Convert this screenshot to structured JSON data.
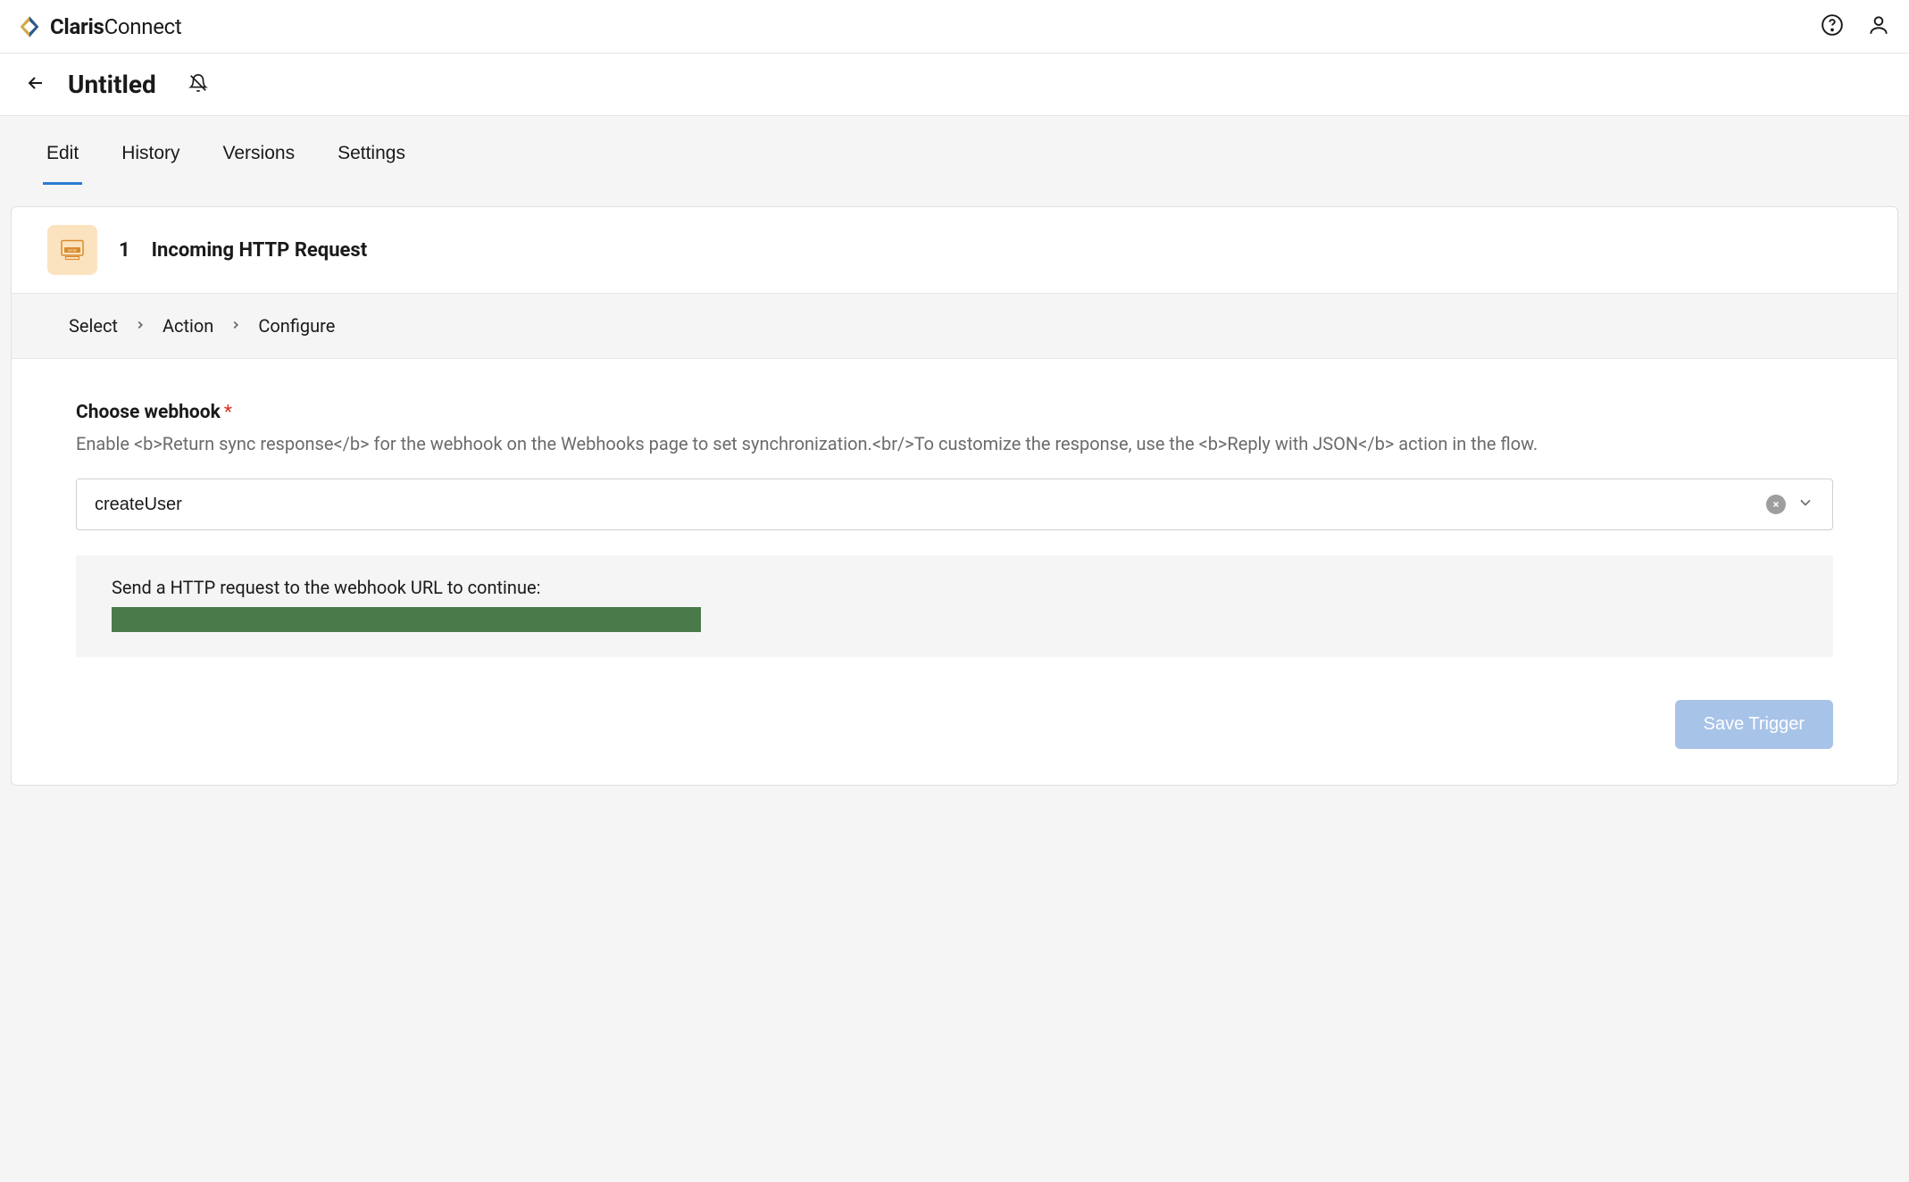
{
  "header": {
    "brand_bold": "Claris",
    "brand_light": "Connect"
  },
  "subheader": {
    "title": "Untitled"
  },
  "tabs": [
    {
      "label": "Edit",
      "active": true
    },
    {
      "label": "History",
      "active": false
    },
    {
      "label": "Versions",
      "active": false
    },
    {
      "label": "Settings",
      "active": false
    }
  ],
  "step": {
    "number": "1",
    "title": "Incoming HTTP Request"
  },
  "breadcrumb": [
    "Select",
    "Action",
    "Configure"
  ],
  "form": {
    "label": "Choose webhook",
    "required_marker": "*",
    "help_text": "Enable <b>Return sync response</b> for the webhook on the Webhooks page to set synchronization.<br/>To customize the response, use the <b>Reply with JSON</b> action in the flow.",
    "value": "createUser",
    "info_text": "Send a HTTP request to the webhook URL to continue:"
  },
  "actions": {
    "save_label": "Save Trigger"
  }
}
